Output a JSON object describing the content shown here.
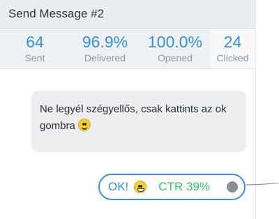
{
  "window": {
    "title": "Send Message #2"
  },
  "stats": [
    {
      "value": "64",
      "label": "Sent"
    },
    {
      "value": "96.9%",
      "label": "Delivered"
    },
    {
      "value": "100.0%",
      "label": "Opened"
    },
    {
      "value": "24",
      "label": "Clicked"
    }
  ],
  "message": {
    "text": "Ne legyél szégyellős, csak kattints az ok gombra",
    "emoji": "smiling-face-emoji"
  },
  "button": {
    "label": "OK!",
    "emoji": "grinning-face-emoji",
    "ctr": "CTR 39%"
  },
  "colors": {
    "accent": "#3a8fd6",
    "ctr_green": "#3bbf6a",
    "titlebar_bg": "#e9edf1",
    "bubble_bg": "#ebedef",
    "connector": "#8a8f95"
  }
}
